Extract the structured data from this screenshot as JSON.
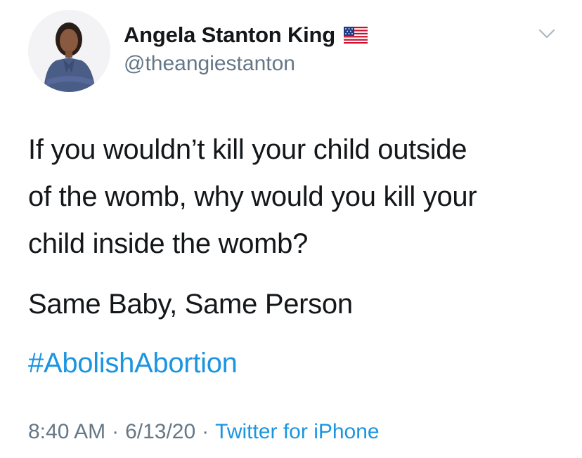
{
  "author": {
    "display_name": "Angela Stanton King",
    "handle": "@theangiestanton",
    "badge_icon": "us-flag-icon"
  },
  "tweet": {
    "lines": [
      "If you wouldn’t kill your child outside",
      "of the womb, why would you kill your",
      "child inside the womb?"
    ],
    "paragraph2": "Same Baby, Same Person",
    "hashtag": "#AbolishAbortion"
  },
  "meta": {
    "time": "8:40 AM",
    "separator": "·",
    "date": "6/13/20",
    "source": "Twitter for iPhone"
  },
  "colors": {
    "text": "#14171a",
    "secondary": "#657786",
    "link": "#1b95e0"
  },
  "icons": {
    "menu": "chevron-down-icon"
  }
}
